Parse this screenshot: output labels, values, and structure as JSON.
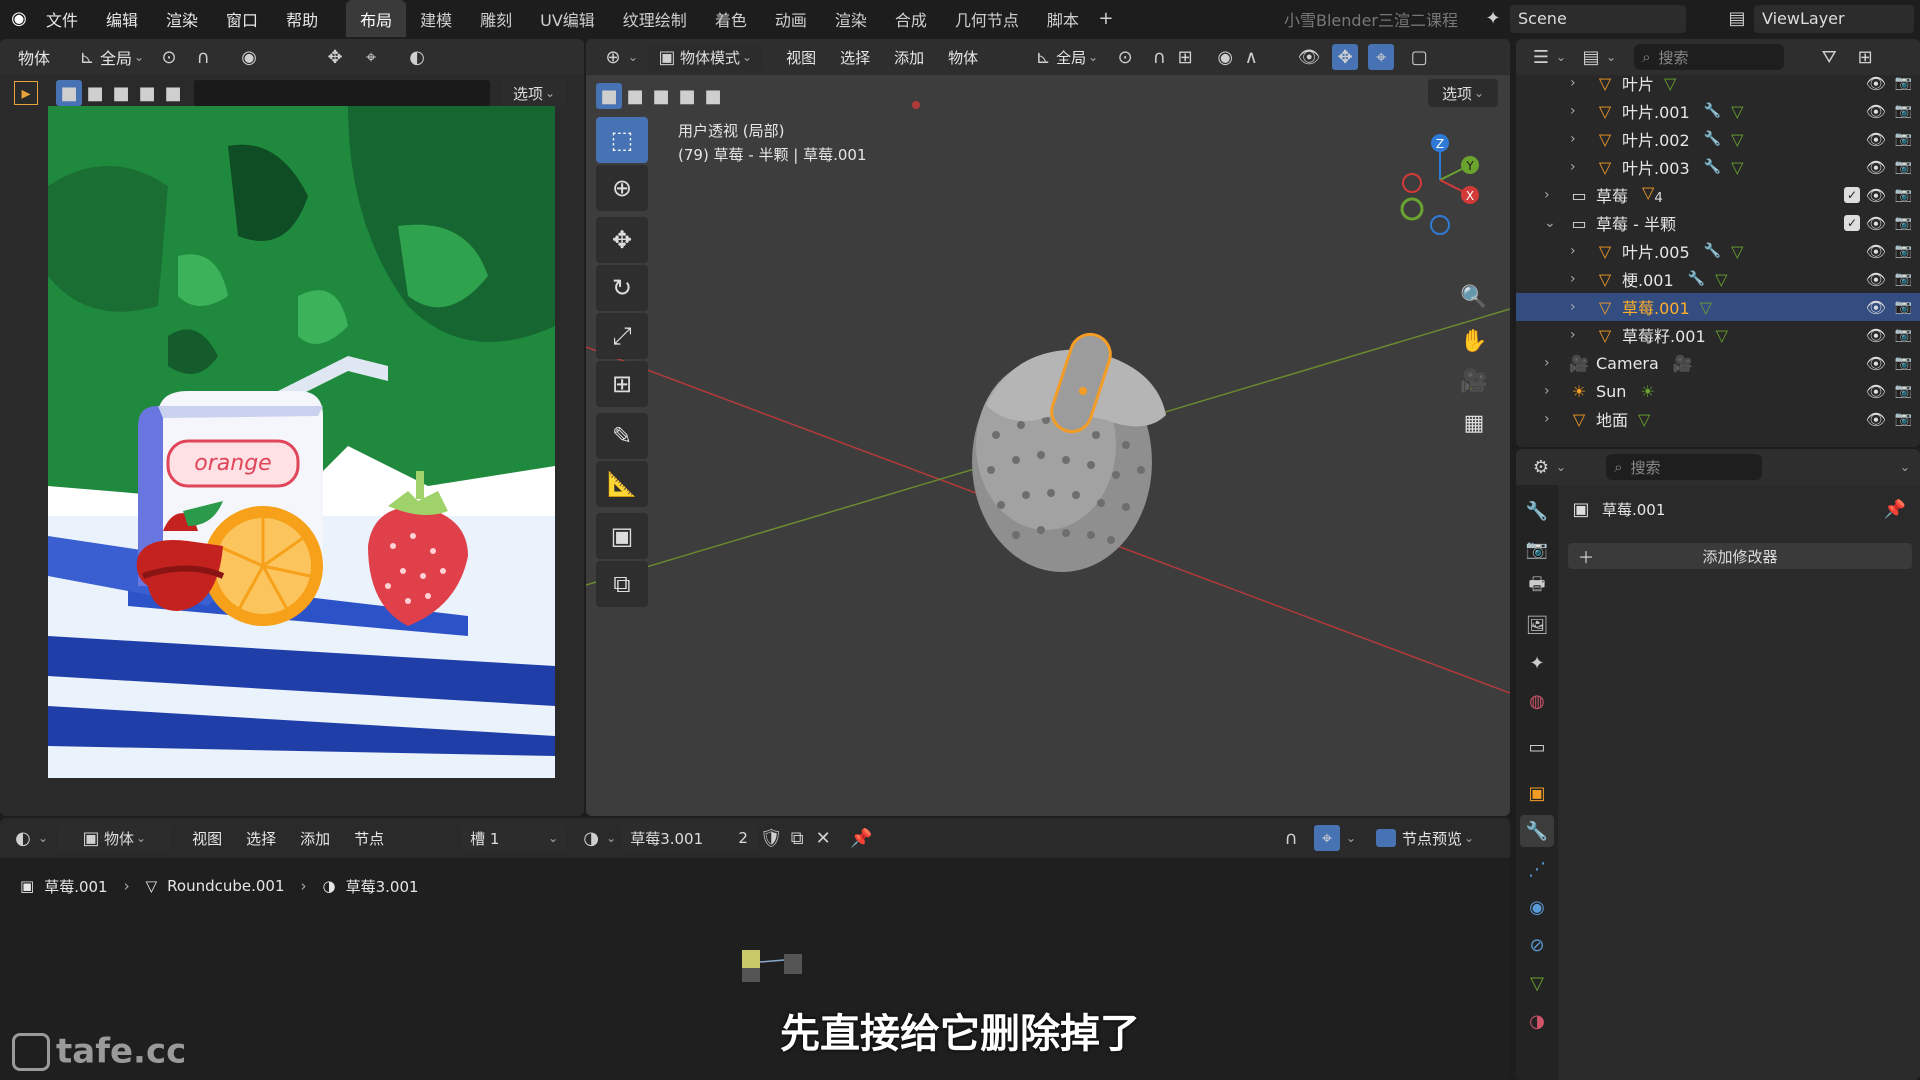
{
  "topbar": {
    "menus": [
      "文件",
      "编辑",
      "渲染",
      "窗口",
      "帮助"
    ],
    "workspaces": [
      "布局",
      "建模",
      "雕刻",
      "UV编辑",
      "纹理绘制",
      "着色",
      "动画",
      "渲染",
      "合成",
      "几何节点",
      "脚本"
    ],
    "active_ws": "布局",
    "channel": "小雪Blender三渲二课程",
    "scene": "Scene",
    "viewlayer": "ViewLayer",
    "plus": "+"
  },
  "imgeditor": {
    "mode": "物体",
    "orient": "全局",
    "options": "选项"
  },
  "art": {
    "box_label": "orange"
  },
  "viewport": {
    "mode": "物体模式",
    "menus": [
      "视图",
      "选择",
      "添加",
      "物体"
    ],
    "orient": "全局",
    "options": "选项",
    "view_name": "用户透视 (局部)",
    "view_obj": "(79) 草莓 - 半颗 | 草莓.001"
  },
  "gizmo": {
    "x": "X",
    "y": "Y",
    "z": "Z"
  },
  "outliner": {
    "search_placeholder": "搜索",
    "rows": [
      {
        "label": "叶片",
        "icon": "mesh",
        "depth": 2,
        "mod": false
      },
      {
        "label": "叶片.001",
        "icon": "mesh",
        "depth": 2,
        "mod": true
      },
      {
        "label": "叶片.002",
        "icon": "mesh",
        "depth": 2,
        "mod": true
      },
      {
        "label": "叶片.003",
        "icon": "mesh",
        "depth": 2,
        "mod": true
      },
      {
        "label": "草莓",
        "icon": "collection",
        "depth": 1,
        "mod": false,
        "count": "4"
      },
      {
        "label": "草莓 - 半颗",
        "icon": "collection",
        "depth": 1,
        "mod": false
      },
      {
        "label": "叶片.005",
        "icon": "mesh",
        "depth": 2,
        "mod": true
      },
      {
        "label": "梗.001",
        "icon": "mesh",
        "depth": 2,
        "mod": true
      },
      {
        "label": "草莓.001",
        "icon": "mesh",
        "depth": 2,
        "mod": false,
        "selected": true
      },
      {
        "label": "草莓籽.001",
        "icon": "mesh",
        "depth": 2,
        "mod": false
      },
      {
        "label": "Camera",
        "icon": "camera",
        "depth": 1,
        "mod": false
      },
      {
        "label": "Sun",
        "icon": "sun",
        "depth": 1,
        "mod": false
      },
      {
        "label": "地面",
        "icon": "mesh",
        "depth": 1,
        "mod": false
      }
    ]
  },
  "props": {
    "search_placeholder": "搜索",
    "object": "草莓.001",
    "add_modifier": "添加修改器"
  },
  "node": {
    "mode": "物体",
    "menus": [
      "视图",
      "选择",
      "添加",
      "节点"
    ],
    "slot": "槽 1",
    "material": "草莓3.001",
    "users": "2",
    "preview": "节点预览",
    "breadcrumb": [
      "草莓.001",
      "Roundcube.001",
      "草莓3.001"
    ]
  },
  "subtitle": "先直接给它删除掉了",
  "watermark": "tafe.cc"
}
